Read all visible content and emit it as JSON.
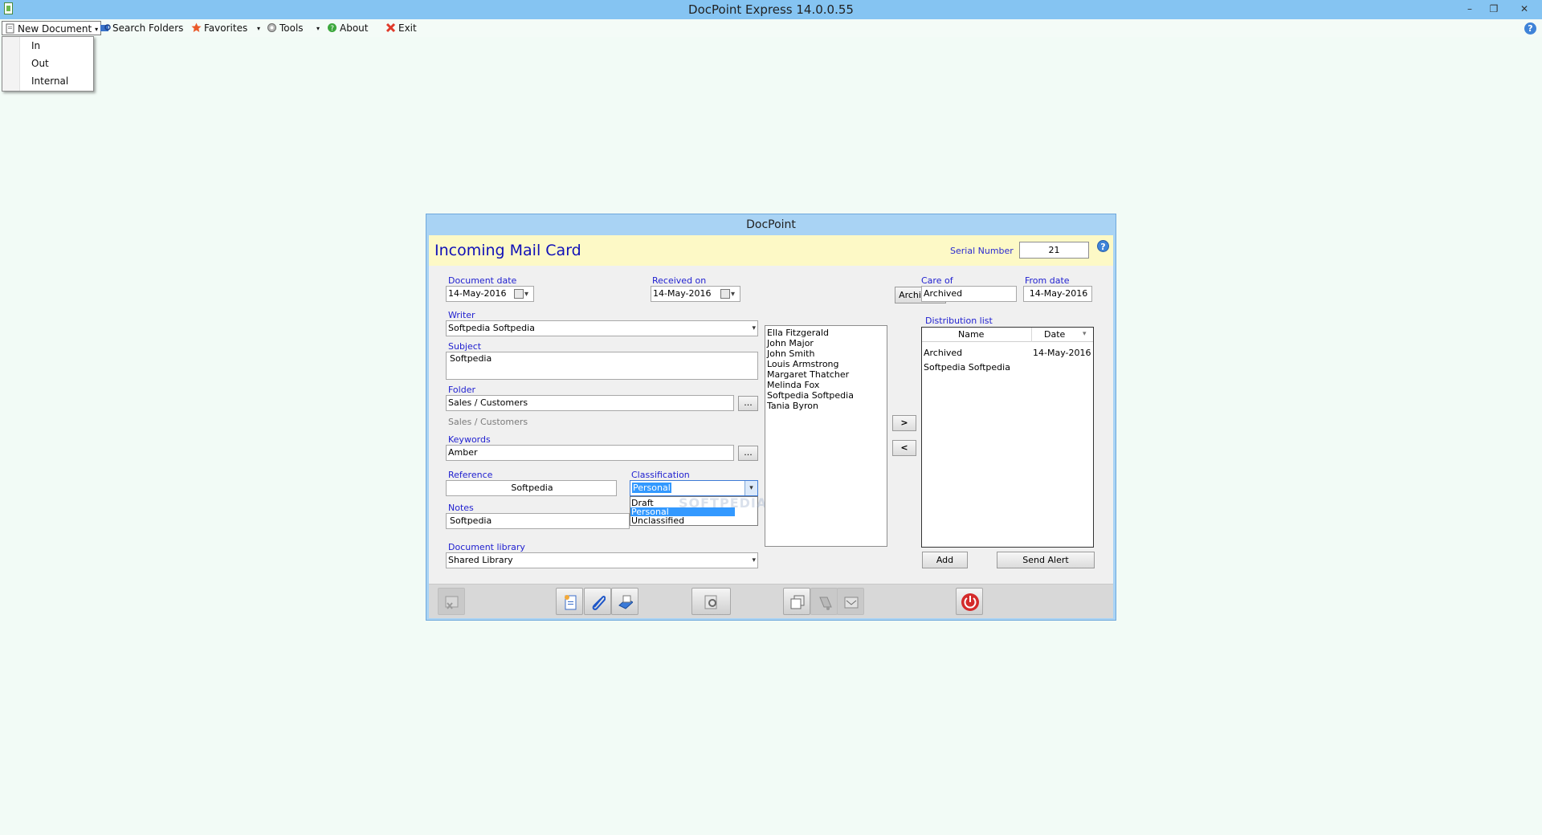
{
  "window": {
    "title": "DocPoint Express   14.0.0.55",
    "minimize": "–",
    "restore": "❐",
    "close": "✕"
  },
  "menubar": {
    "new_document": "New Document",
    "search_folders": "Search Folders",
    "favorites": "Favorites",
    "tools": "Tools",
    "about": "About",
    "exit": "Exit",
    "caret": "▾",
    "help": "?",
    "new_document_menu": [
      "In",
      "Out",
      "Internal"
    ]
  },
  "dialog": {
    "title": "DocPoint",
    "card_title": "Incoming Mail Card",
    "serial_label": "Serial Number",
    "serial_value": "21",
    "help": "?",
    "document_date_label": "Document date",
    "document_date": "14-May-2016",
    "received_on_label": "Received on",
    "received_on": "14-May-2016",
    "archive_button": "Archive >",
    "care_of_label": "Care of",
    "care_of": "Archived",
    "from_date_label": "From date",
    "from_date": "14-May-2016",
    "writer_label": "Writer",
    "writer": "Softpedia Softpedia",
    "subject_label": "Subject",
    "subject": "Softpedia",
    "folder_label": "Folder",
    "folder": "Sales / Customers",
    "folder_path": "Sales / Customers",
    "keywords_label": "Keywords",
    "keywords": "Amber",
    "browse": "...",
    "reference_label": "Reference",
    "reference": "Softpedia",
    "classification_label": "Classification",
    "classification": "Personal",
    "classification_options": [
      "Draft",
      "Personal",
      "Unclassified"
    ],
    "notes_label": "Notes",
    "notes": "Softpedia",
    "document_library_label": "Document library",
    "document_library": "Shared Library",
    "watermark": "SOFTPEDIA",
    "people": [
      "Ella Fitzgerald",
      "John Major",
      "John Smith",
      "Louis Armstrong",
      "Margaret Thatcher",
      "Melinda Fox",
      "Softpedia Softpedia",
      "Tania Byron"
    ],
    "move_right": ">",
    "move_left": "<",
    "distribution_label": "Distribution list",
    "dist_col_name": "Name",
    "dist_col_date": "Date",
    "distribution": [
      {
        "name": "Archived",
        "date": "14-May-2016"
      },
      {
        "name": "Softpedia Softpedia",
        "date": ""
      }
    ],
    "add_button": "Add",
    "send_alert_button": "Send Alert"
  },
  "toolbar_icons": [
    "delete-card-icon",
    "new-document-icon",
    "attach-icon",
    "scan-icon",
    "preview-icon",
    "copy-icon",
    "broadcast-icon",
    "email-icon",
    "power-icon"
  ],
  "colors": {
    "accent_label": "#2121d0",
    "title_blue": "#1010b8",
    "header_yellow": "#fdf9c6",
    "selection": "#3399ff",
    "titlebar": "#85c4f2"
  }
}
